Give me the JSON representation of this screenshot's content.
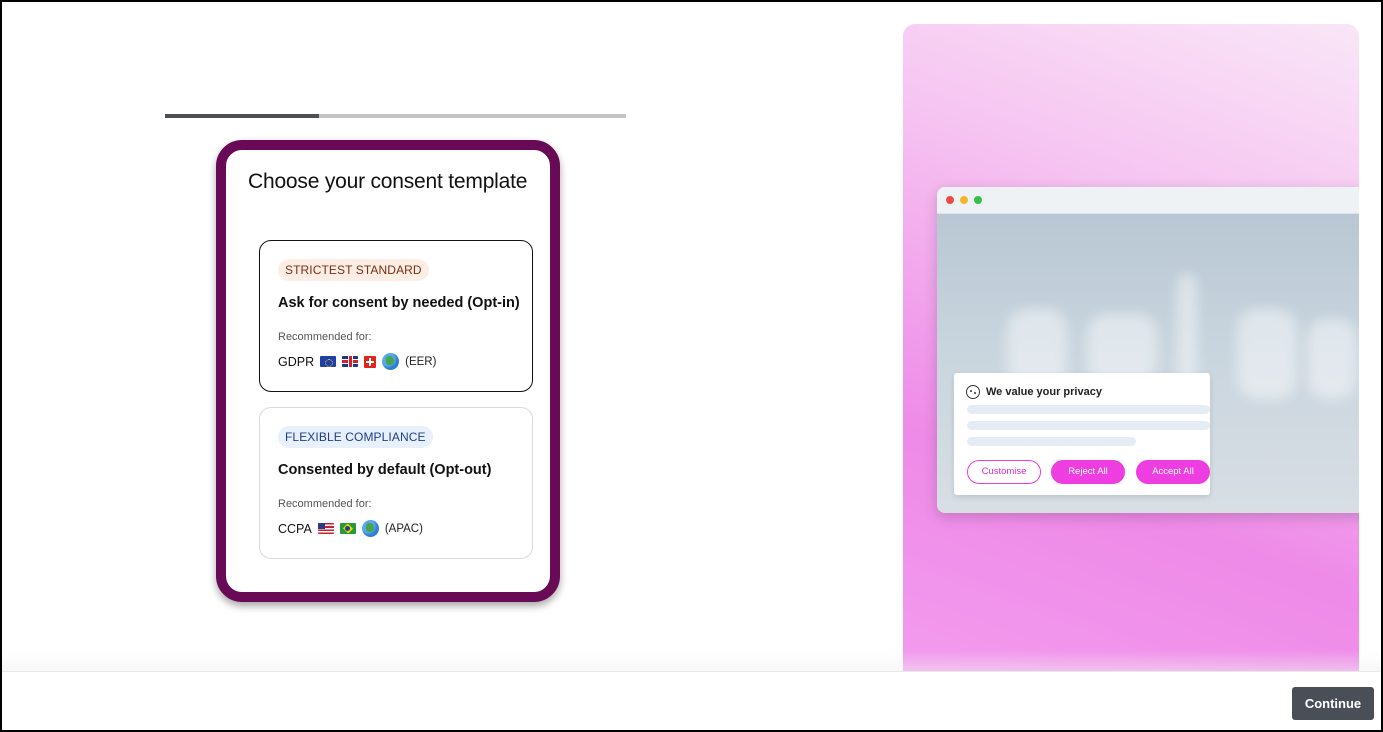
{
  "progress": {
    "value": 0.333
  },
  "panel": {
    "title": "Choose your consent template",
    "options": [
      {
        "badge": "STRICTEST STANDARD",
        "title": "Ask for consent by needed (Opt-in)",
        "recommended_label": "Recommended for:",
        "law": "GDPR",
        "flags": [
          "eu-flag-icon",
          "uk-flag-icon",
          "swiss-flag-icon",
          "globe-europe-icon"
        ],
        "region": "(EER)",
        "selected": true
      },
      {
        "badge": "FLEXIBLE COMPLIANCE",
        "title": "Consented by default (Opt-out)",
        "recommended_label": "Recommended for:",
        "law": "CCPA",
        "flags": [
          "us-flag-icon",
          "brazil-flag-icon",
          "globe-asia-icon"
        ],
        "region": "(APAC)",
        "selected": false
      }
    ]
  },
  "preview": {
    "cookie_title": "We value your privacy",
    "buttons": {
      "customise": "Customise",
      "reject": "Reject All",
      "accept": "Accept All"
    },
    "colors": {
      "accent": "#ee3de0",
      "panel_border": "#680a55"
    }
  },
  "footer": {
    "continue_label": "Continue"
  }
}
